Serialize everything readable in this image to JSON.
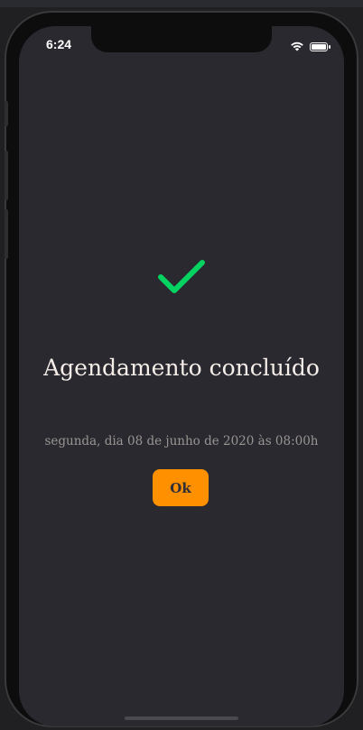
{
  "status_bar": {
    "time": "6:24",
    "icons": [
      "wifi-icon",
      "battery-icon"
    ]
  },
  "confirmation": {
    "icon": "check-icon",
    "title": "Agendamento concluído",
    "subtitle": "segunda, dia 08 de junho de 2020 às 08:00h",
    "ok_label": "Ok"
  },
  "colors": {
    "background": "#2a2930",
    "check": "#04d361",
    "title": "#f4ede8",
    "subtitle": "#999591",
    "button": "#ff9000",
    "button_text": "#312e38"
  }
}
